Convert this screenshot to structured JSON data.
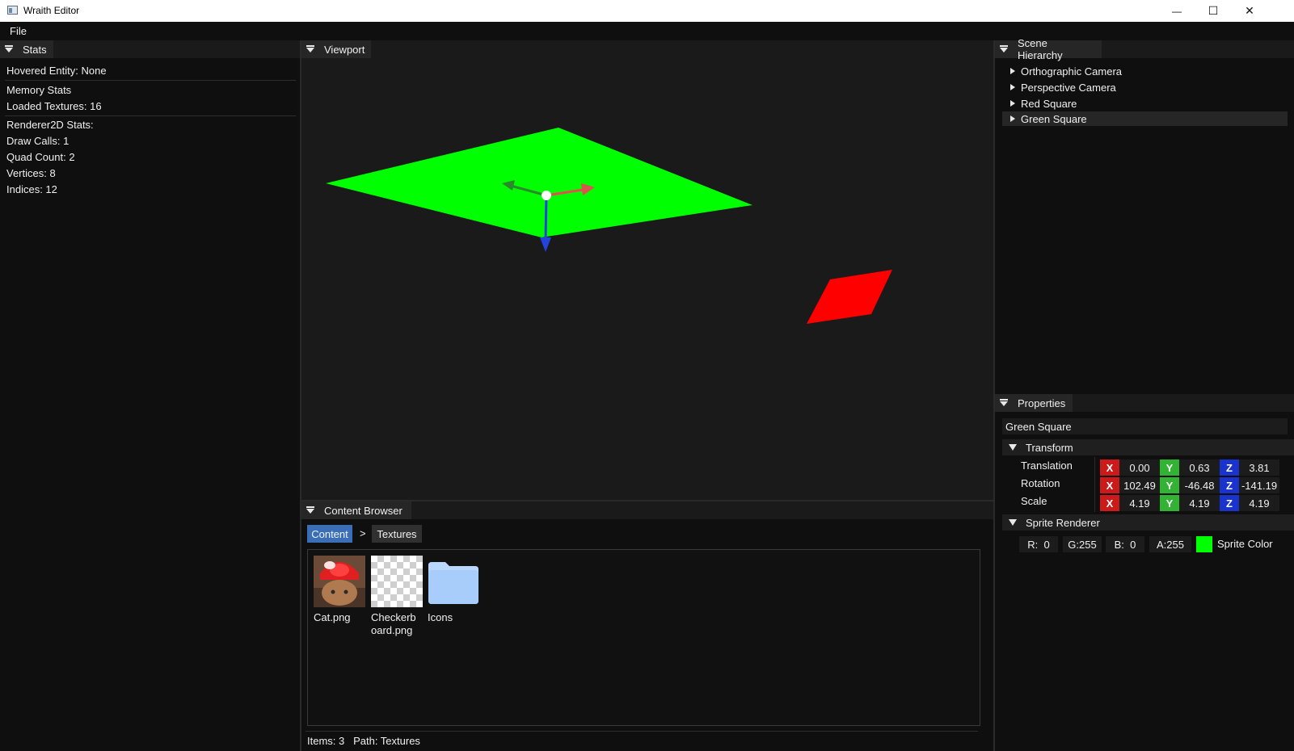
{
  "window": {
    "title": "Wraith Editor",
    "minimize": "—",
    "maximize": "☐",
    "close": "✕"
  },
  "menubar": {
    "file": "File"
  },
  "stats": {
    "tab": "Stats",
    "hovered": "Hovered Entity: None",
    "memory_title": "Memory Stats",
    "loaded_textures": "Loaded Textures: 16",
    "renderer_title": "Renderer2D Stats:",
    "draw_calls": "Draw Calls: 1",
    "quad_count": "Quad Count: 2",
    "vertices": "Vertices: 8",
    "indices": "Indices: 12"
  },
  "viewport": {
    "tab": "Viewport",
    "colors": {
      "background": "#1a1a1a",
      "green_square": "#00ff00",
      "red_square": "#ff0000",
      "gizmo_x": "#e05050",
      "gizmo_y": "#2a8a2a",
      "gizmo_z": "#2244dd"
    }
  },
  "content_browser": {
    "tab": "Content Browser",
    "breadcrumb": [
      "Content",
      ">",
      "Textures"
    ],
    "items": [
      {
        "line1": "Cat.png",
        "line2": "",
        "icon": "cat-image-thumbnail"
      },
      {
        "line1": "Checkerb",
        "line2": "oard.png",
        "icon": "checkerboard-thumbnail"
      },
      {
        "line1": "Icons",
        "line2": "",
        "icon": "folder-icon"
      }
    ],
    "status": "Items: 3   Path: Textures"
  },
  "scene_hierarchy": {
    "tab": "Scene Hierarchy",
    "items": [
      "Orthographic Camera",
      "Perspective Camera",
      "Red Square",
      "Green Square"
    ],
    "selected": "Green Square"
  },
  "properties": {
    "tab": "Properties",
    "name": "Green Square",
    "transform": {
      "header": "Transform",
      "rows": [
        {
          "label": "Translation",
          "x": "0.00",
          "y": "0.63",
          "z": "3.81"
        },
        {
          "label": "Rotation",
          "x": "102.49",
          "y": "-46.48",
          "z": "-141.19"
        },
        {
          "label": "Scale",
          "x": "4.19",
          "y": "4.19",
          "z": "4.19"
        }
      ],
      "axis_x": "X",
      "axis_y": "Y",
      "axis_z": "Z"
    },
    "sprite": {
      "header": "Sprite Renderer",
      "r": "R:  0",
      "g": "G:255",
      "b": "B:  0",
      "a": "A:255",
      "swatch": "#00ff00",
      "label": "Sprite Color"
    }
  }
}
